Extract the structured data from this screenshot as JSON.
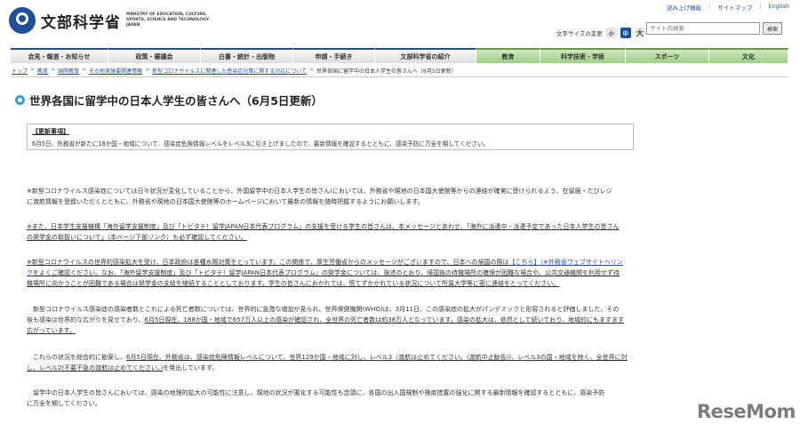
{
  "header": {
    "logo_jp": "文部科学省",
    "logo_en": "MINISTRY OF EDUCATION, CULTURE, SPORTS, SCIENCE AND TECHNOLOGY-JAPAN",
    "utility_links": [
      "読み上げ機能",
      "サイトマップ",
      "English"
    ],
    "fontsize_label": "文字サイズの変更",
    "fontsize_small": "小",
    "fontsize_medium": "中",
    "fontsize_large": "大",
    "search_placeholder": "サイト内検索",
    "search_button": "検索"
  },
  "nav": {
    "items": [
      "会見・報道・お知らせ",
      "政策・審議会",
      "白書・統計・出版物",
      "申請・手続き",
      "文部科学省の紹介",
      "教育",
      "科学技術・学術",
      "スポーツ",
      "文化"
    ]
  },
  "breadcrumb": {
    "items": [
      "トップ",
      "教育",
      "国際教育",
      "その他実施要関連情報",
      "新型コロナウイルスに関連した感染症対策に関する対応について"
    ],
    "current": "世界各国に留学中の日本人学生の皆さんへ（6月5日更新）"
  },
  "page": {
    "title": "世界各国に留学中の日本人学生の皆さんへ（6月5日更新）",
    "update_head": "【更新事項】",
    "update_text": "6月5日、外務省が新たに18か国・地域について、感染症危険情報レベルをレベル3に引き上げましたので、最新情報を確認するとともに、感染予防に万全を期してください。"
  },
  "paragraphs": {
    "p1_l1": "※新型コロナウイルス感染症については日々状況が変化していることから、外国留学中の日本人学生の皆さん(においては、外務省や現地の日本国大使館等からの連絡が確実に受けられるよう、在留届・たびレジ",
    "p1_l2": "に渡航情報を登録いただくとともに、外務省や現地の日本国大使館等のホームページにおいて最新の情報を随時把握するようにお願いします。",
    "p2_l1": "※また、日本学生支援機構「海外留学支援制度」及び「トビタテ！留学JAPAN日本代表プログラム」の支援を受ける学生の皆さんは、本メッセージとあわせ、「海外に派遣中・派遣予定であった日本人学生の皆さん",
    "p2_l2": "の奨学金の取扱いについて」（本ページ下部リンク）も必ず確認してください。",
    "p3_l1a": "※新型コロナウイルスの世界的感染拡大を受け、日本政府は各種水際対策をとっています。この関係で、厚生労働省からのメッセージがございますので、日本への帰国の際は",
    "p3_link1": "【こちら】",
    "p3_link2": "（※外務省ウェブサイトへリン",
    "p3_l2a": "ク",
    "p3_l2b": "をよくご確認ください。なお、「海外留学支援制度」及び「トビタテ！留学JAPAN日本代表プログラム」の奨学金については、後述のとおり、帰国後の待機場所の確保が困難な場合や、公共交通機関を利用せず待",
    "p3_l3": "機場所に向かうことが困難である場合は奨学金の支給を継続することとしております。学生の皆さんにおかれては、慌てずかかれている状況について所属大学等に密に連絡をとってください。",
    "p4_l1": "　新型コロナウイルス感染症の感染者数とこれによる死亡者数については、世界的に急激な増加が見られ、世界保健機関(WHO)は、3月11日、この感染症の拡大がパンデミックと形容されると評価しました。その",
    "p4_l2a": "後も感染は世界的な広がりを見せており、",
    "p4_l2b": "6月5日現在、188か国・地域で657万人以上の感染が確認され、全世界の死亡者数は約38万人となっています。感染の拡大は、依然として続いており、地域的にもますます",
    "p4_l3": "広がっています。",
    "p5_l1a": "　これらの状況を総合的に勘案し、",
    "p5_l1b": "6月5日現在、外務省は、感染症危険情報レベルについて、世界129か国・地域に対し、レベル3（渡航は止めてください。(渡航中止勧告))、レベル3の国・地域を除く、全世界に対",
    "p5_l2": "し、レベル2(不要不急の渡航は止めてください。)",
    "p5_l2b": "を発出しています。",
    "p6_l1": "　留学中の日本人学生の皆さんにおいては、感染の地理的拡大の可能性に注意し、現地の状況が悪化する可能性も念頭に、各国の出入国規制や検疫措置の強化に関する最新情報を確認するとともに、感染予防",
    "p6_l2": "に万全を期してください。"
  },
  "watermark": {
    "text": "ReseMom"
  }
}
